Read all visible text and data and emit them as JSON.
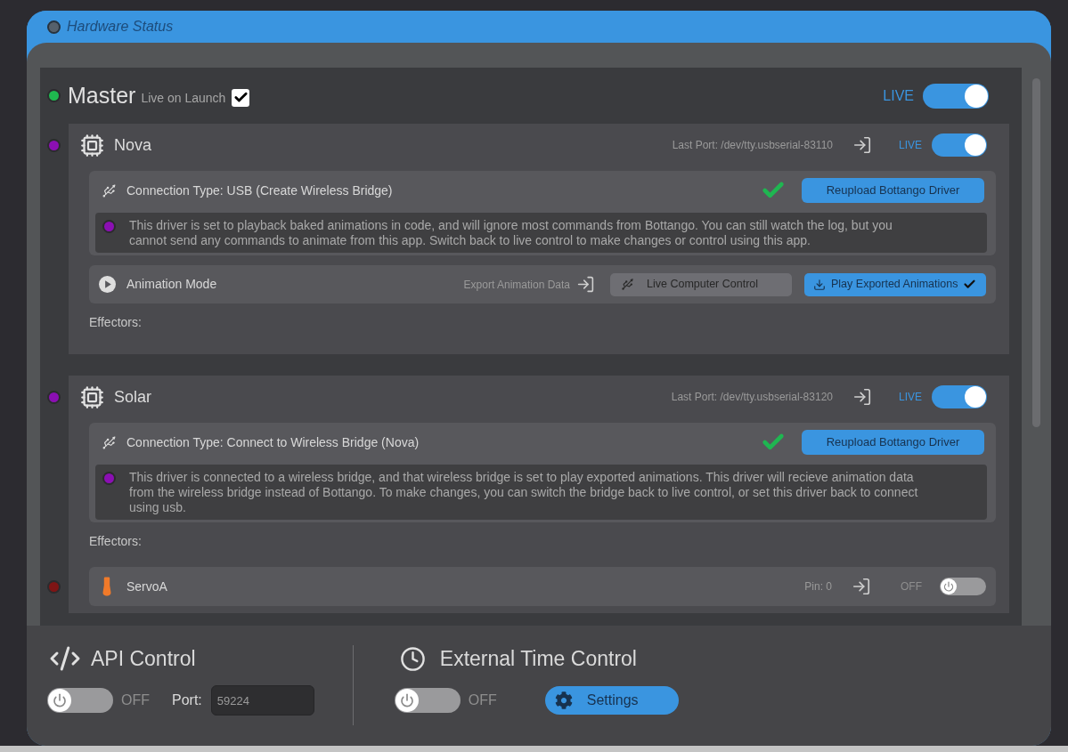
{
  "window": {
    "title": "Hardware Status"
  },
  "master": {
    "name": "Master",
    "color": "#1fb84f",
    "live_on_launch": {
      "label": "Live on Launch",
      "checked": true
    },
    "live_toggle": {
      "label": "LIVE",
      "on": true
    }
  },
  "devices": [
    {
      "name": "Nova",
      "color": "#8b0fb3",
      "last_port": "Last Port: /dev/tty.usbserial-83110",
      "live_toggle": {
        "label": "LIVE",
        "on": true
      },
      "connection": {
        "label": "Connection Type: USB (Create Wireless Bridge)",
        "verified": true,
        "button": "Reupload Bottango Driver"
      },
      "note": {
        "color": "#8b0fb3",
        "text": "This driver is set to playback baked animations in code, and will ignore most commands from Bottango. You can still watch the log, but you cannot send any commands to animate from this app. Switch back to live control to make changes or control using this app."
      },
      "animation_mode": {
        "label": "Animation Mode",
        "export_label": "Export Animation Data",
        "options": [
          {
            "kind": "live",
            "label": "Live Computer Control",
            "selected": false
          },
          {
            "kind": "exported",
            "label": "Play Exported Animations",
            "selected": true
          }
        ]
      },
      "effectors_label": "Effectors:"
    },
    {
      "name": "Solar",
      "color": "#8b0fb3",
      "last_port": "Last Port: /dev/tty.usbserial-83120",
      "live_toggle": {
        "label": "LIVE",
        "on": true
      },
      "connection": {
        "label": "Connection Type: Connect to Wireless Bridge (Nova)",
        "verified": true,
        "button": "Reupload Bottango Driver"
      },
      "note": {
        "color": "#8b0fb3",
        "text": "This driver is connected to a wireless bridge, and that wireless bridge is set to play exported animations. This driver will recieve animation data from the wireless bridge instead of Bottango. To make changes, you can switch the bridge back to live control, or set this driver back to connect using usb."
      },
      "effectors_label": "Effectors:",
      "effectors": [
        {
          "name": "ServoA",
          "color": "#7e1515",
          "pin": "Pin: 0",
          "toggle": {
            "label": "OFF",
            "on": false
          }
        }
      ]
    }
  ],
  "api_control": {
    "title": "API Control",
    "toggle": {
      "label": "OFF",
      "on": false
    },
    "port_label": "Port:",
    "port": "59224"
  },
  "time_control": {
    "title": "External Time Control",
    "toggle": {
      "label": "OFF",
      "on": false
    },
    "settings_button": "Settings"
  }
}
